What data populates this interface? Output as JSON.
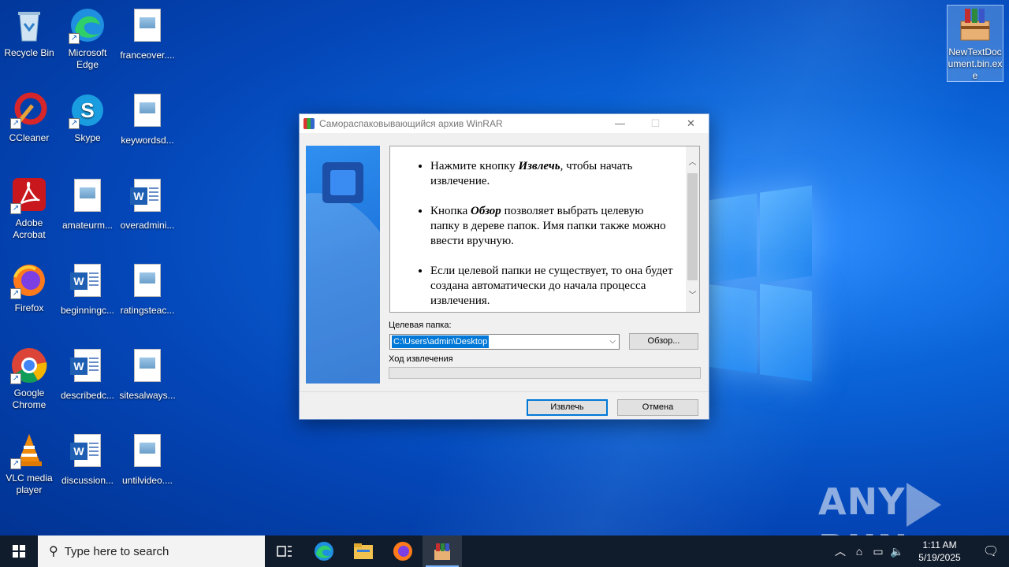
{
  "desktop": {
    "icons": [
      {
        "label": "Recycle Bin",
        "icon": "recycle-bin-icon"
      },
      {
        "label": "Microsoft Edge",
        "icon": "edge-icon"
      },
      {
        "label": "franceover....",
        "icon": "image-file-icon"
      },
      {
        "label": "CCleaner",
        "icon": "ccleaner-icon"
      },
      {
        "label": "Skype",
        "icon": "skype-icon"
      },
      {
        "label": "keywordsd...",
        "icon": "image-file-icon"
      },
      {
        "label": "Adobe Acrobat",
        "icon": "acrobat-icon"
      },
      {
        "label": "amateurm...",
        "icon": "image-file-icon"
      },
      {
        "label": "overadmini...",
        "icon": "word-doc-icon"
      },
      {
        "label": "Firefox",
        "icon": "firefox-icon"
      },
      {
        "label": "beginningc...",
        "icon": "word-doc-icon"
      },
      {
        "label": "ratingsteac...",
        "icon": "image-file-icon"
      },
      {
        "label": "Google Chrome",
        "icon": "chrome-icon"
      },
      {
        "label": "describedc...",
        "icon": "word-doc-icon"
      },
      {
        "label": "sitesalways...",
        "icon": "image-file-icon"
      },
      {
        "label": "VLC media player",
        "icon": "vlc-icon"
      },
      {
        "label": "discussion...",
        "icon": "word-doc-icon"
      },
      {
        "label": "untilvideo....",
        "icon": "image-file-icon"
      },
      {
        "label": "NewTextDocument.bin.exe",
        "icon": "winrar-sfx-icon"
      }
    ]
  },
  "dialog": {
    "title": "Самораспаковывающийся архив WinRAR",
    "info": [
      {
        "pre": "Нажмите кнопку ",
        "bold": "Извлечь",
        "post": ", чтобы начать извлечение."
      },
      {
        "pre": "Кнопка ",
        "bold": "Обзор",
        "post": " позволяет выбрать целевую папку в дереве папок. Имя папки также можно ввести вручную."
      },
      {
        "pre": "",
        "bold": "",
        "post": "Если целевой папки не существует, то она будет создана автоматически до начала процесса извлечения."
      }
    ],
    "target_label": "Целевая папка:",
    "target_value": "C:\\Users\\admin\\Desktop",
    "browse_label": "Обзор...",
    "progress_label": "Ход извлечения",
    "progress": 0,
    "extract_label": "Извлечь",
    "cancel_label": "Отмена"
  },
  "watermark": {
    "left": "ANY",
    "right": "RUN"
  },
  "taskbar": {
    "search_placeholder": "Type here to search",
    "pinned": [
      "task-view-icon",
      "edge-icon",
      "file-explorer-icon",
      "firefox-icon",
      "winrar-icon"
    ],
    "time": "1:11 AM",
    "date": "5/19/2025"
  }
}
